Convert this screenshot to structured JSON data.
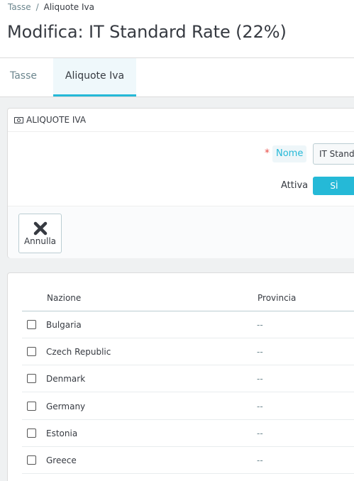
{
  "breadcrumb": {
    "parent": "Tasse",
    "separator": "/",
    "current": "Aliquote Iva"
  },
  "page_title": "Modifica: IT Standard Rate (22%)",
  "tabs": [
    {
      "label": "Tasse",
      "active": false
    },
    {
      "label": "Aliquote Iva",
      "active": true
    }
  ],
  "form": {
    "heading": "ALIQUOTE IVA",
    "heading_icon": "money-icon",
    "required_mark": "*",
    "name_label": "Nome",
    "name_value": "IT Standa",
    "active_label": "Attiva",
    "active_yes": "SÌ",
    "cancel_label": "Annulla",
    "cancel_icon": "close-icon"
  },
  "table": {
    "columns": [
      "Nazione",
      "Provincia"
    ],
    "rows": [
      {
        "country": "Bulgaria",
        "province": "--"
      },
      {
        "country": "Czech Republic",
        "province": "--"
      },
      {
        "country": "Denmark",
        "province": "--"
      },
      {
        "country": "Germany",
        "province": "--"
      },
      {
        "country": "Estonia",
        "province": "--"
      },
      {
        "country": "Greece",
        "province": "--"
      }
    ]
  },
  "colors": {
    "accent": "#25b9d7",
    "required": "#e84e48",
    "text": "#363a41",
    "muted": "#6c868e"
  }
}
